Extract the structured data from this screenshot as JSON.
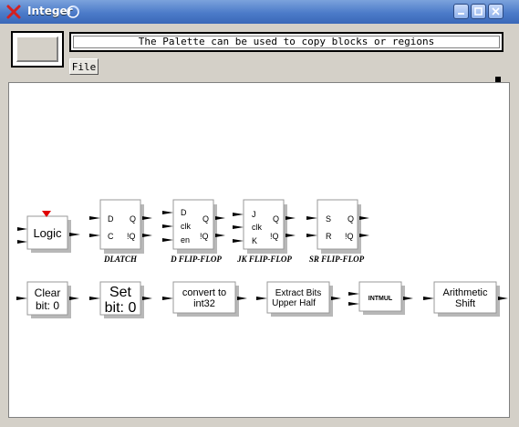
{
  "window": {
    "title": "Integer"
  },
  "toolbar": {
    "message": "The Palette can be used to copy blocks or regions",
    "file_menu": "File"
  },
  "blocks": {
    "logic": {
      "text": "Logic"
    },
    "dlatch": {
      "label": "DLATCH",
      "in1": "D",
      "in2": "C",
      "out1": "Q",
      "out2": "!Q"
    },
    "dff": {
      "label": "D FLIP-FLOP",
      "in1": "D",
      "in2": "clk",
      "in3": "en",
      "out1": "Q",
      "out2": "!Q"
    },
    "jkff": {
      "label": "JK FLIP-FLOP",
      "in1": "J",
      "in2": "clk",
      "in3": "K",
      "out1": "Q",
      "out2": "!Q"
    },
    "srff": {
      "label": "SR FLIP-FLOP",
      "in1": "S",
      "in2": "R",
      "out1": "Q",
      "out2": "!Q"
    },
    "clearbit": {
      "line1": "Clear",
      "line2": "bit: 0"
    },
    "setbit": {
      "line1": "Set",
      "line2": "bit: 0"
    },
    "convert": {
      "line1": "convert to",
      "line2": "int32"
    },
    "extract": {
      "line1": "Extract  Bits",
      "line2": "Upper Half"
    },
    "intmul": {
      "text": "INTMUL"
    },
    "shift": {
      "line1": "Arithmetic",
      "line2": "Shift"
    }
  },
  "colors": {
    "title_bar": "#4c7bc9",
    "logic_marker": "#e00000",
    "block_shadow": "#b8b8b8"
  }
}
